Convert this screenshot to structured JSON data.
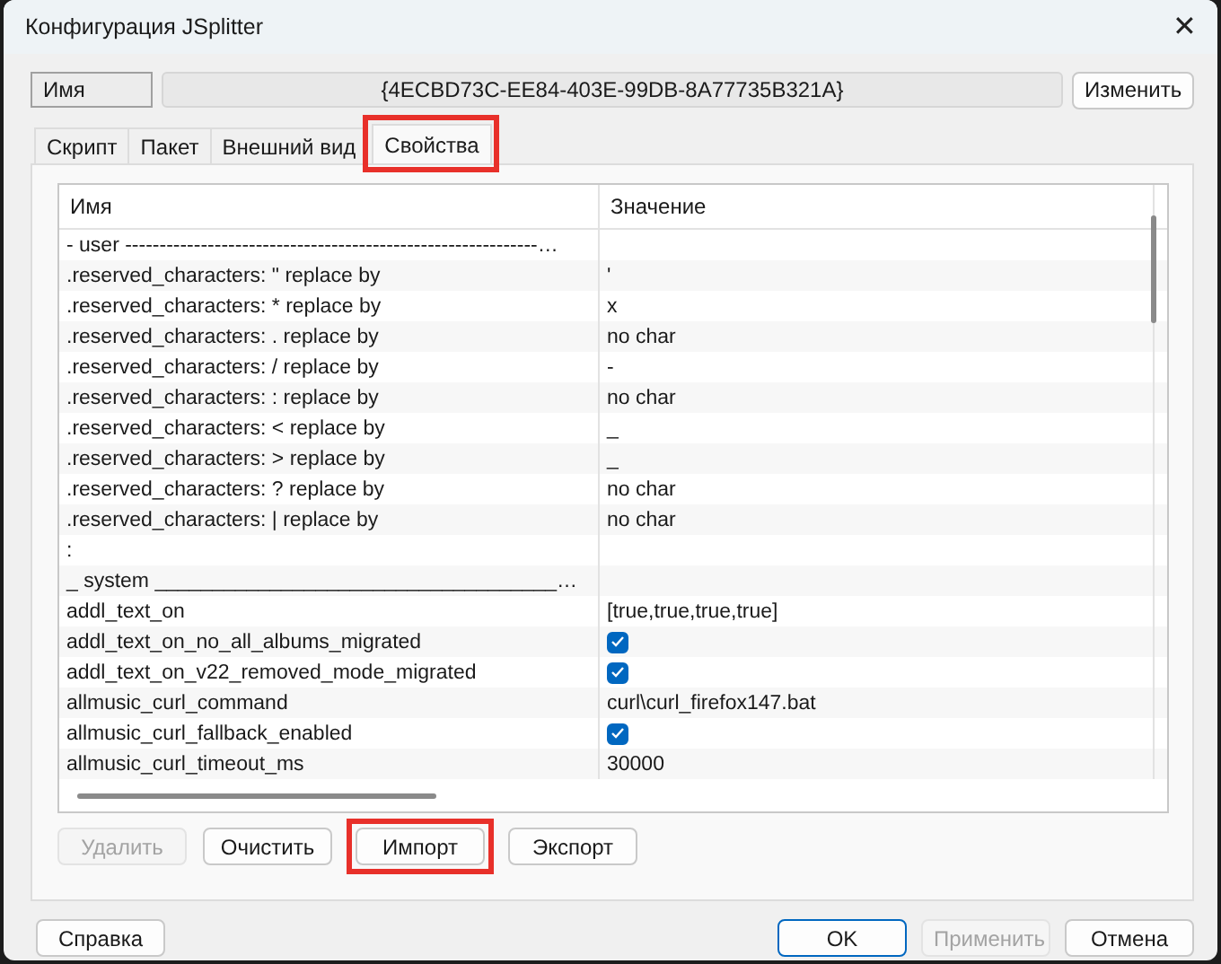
{
  "window": {
    "title": "Конфигурация JSplitter",
    "close": "✕"
  },
  "name_row": {
    "label": "Имя",
    "value": "{4ECBD73C-EE84-403E-99DB-8A77735B321A}",
    "button": "Изменить"
  },
  "tabs": [
    {
      "label": "Скрипт",
      "selected": false,
      "highlighted": false
    },
    {
      "label": "Пакет",
      "selected": false,
      "highlighted": false
    },
    {
      "label": "Внешний вид",
      "selected": false,
      "highlighted": false
    },
    {
      "label": "Свойства",
      "selected": true,
      "highlighted": true
    }
  ],
  "table": {
    "columns": [
      "Имя",
      "Значение"
    ],
    "rows": [
      {
        "name": "- user ------------------------------------------------------------…",
        "kind": "text"
      },
      {
        "name": ".reserved_characters: \" replace by",
        "kind": "text",
        "value": "'"
      },
      {
        "name": ".reserved_characters: * replace by",
        "kind": "text",
        "value": "x"
      },
      {
        "name": ".reserved_characters: . replace by",
        "kind": "text",
        "value": "no char"
      },
      {
        "name": ".reserved_characters: / replace by",
        "kind": "text",
        "value": "-"
      },
      {
        "name": ".reserved_characters: : replace by",
        "kind": "text",
        "value": "no char"
      },
      {
        "name": ".reserved_characters: < replace by",
        "kind": "text",
        "value": "_"
      },
      {
        "name": ".reserved_characters: > replace by",
        "kind": "text",
        "value": "_"
      },
      {
        "name": ".reserved_characters: ? replace by",
        "kind": "text",
        "value": "no char"
      },
      {
        "name": ".reserved_characters: | replace by",
        "kind": "text",
        "value": "no char"
      },
      {
        "name": ":",
        "kind": "text"
      },
      {
        "name": "_ system ___________________________________…",
        "kind": "text"
      },
      {
        "name": "addl_text_on",
        "kind": "text",
        "value": "[true,true,true,true]"
      },
      {
        "name": "addl_text_on_no_all_albums_migrated",
        "kind": "check",
        "checked": true
      },
      {
        "name": "addl_text_on_v22_removed_mode_migrated",
        "kind": "check",
        "checked": true
      },
      {
        "name": "allmusic_curl_command",
        "kind": "text",
        "value": "curl\\curl_firefox147.bat"
      },
      {
        "name": "allmusic_curl_fallback_enabled",
        "kind": "check",
        "checked": true
      },
      {
        "name": "allmusic_curl_timeout_ms",
        "kind": "text",
        "value": "30000"
      }
    ]
  },
  "panel_buttons": [
    {
      "label": "Удалить",
      "disabled": true,
      "highlighted": false
    },
    {
      "label": "Очистить",
      "disabled": false,
      "highlighted": false
    },
    {
      "label": "Импорт",
      "disabled": false,
      "highlighted": true
    },
    {
      "label": "Экспорт",
      "disabled": false,
      "highlighted": false
    }
  ],
  "help_button": "Справка",
  "dialog_buttons": [
    {
      "label": "OK",
      "disabled": false,
      "default": true
    },
    {
      "label": "Применить",
      "disabled": true,
      "default": false
    },
    {
      "label": "Отмена",
      "disabled": false,
      "default": false
    }
  ]
}
